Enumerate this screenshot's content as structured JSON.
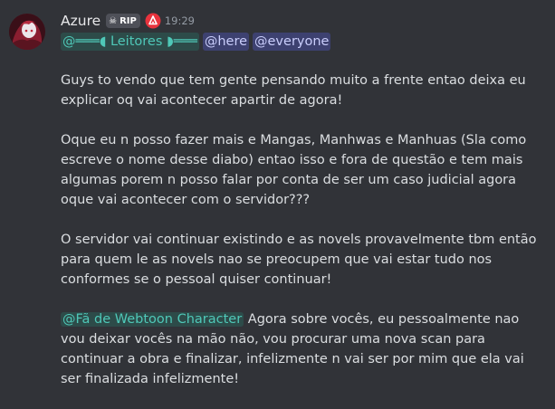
{
  "message": {
    "author": "Azure",
    "tag_icon": "skull-icon",
    "tag_label": "RIP",
    "badge_icon": "red-alert-badge-icon",
    "timestamp": "19:29",
    "mentions": {
      "role": "@═══◖ Leitores ◗═══",
      "here": "@here",
      "everyone": "@everyone"
    },
    "paragraphs": [
      "Guys to vendo que tem gente pensando muito a frente entao deixa eu explicar oq vai acontecer apartir de agora!",
      "Oque eu n posso fazer mais e Mangas, Manhwas e Manhuas (Sla como escreve o nome desse diabo) entao isso e fora de questão e tem mais algumas porem n posso falar por conta de ser um caso judicial agora oque vai acontecer com o servidor???",
      "O servidor vai continuar existindo e as novels provavelmente tbm então para quem le as novels nao se preocupem que vai estar tudo nos conformes se o pessoal quiser continuar!"
    ],
    "last_paragraph": {
      "mention": "@Fã de Webtoon Character",
      "text": " Agora sobre vocês, eu pessoalmente nao vou deixar vocês na mão não, vou procurar uma nova scan para continuar a obra e finalizar, infelizmente n vai ser por mim que ela vai ser finalizada infelizmente!"
    }
  },
  "colors": {
    "background": "#313338",
    "text": "#dbdee1",
    "mention_bg": "#3c4270",
    "mention_text": "#c9cdfb",
    "role_mention_text": "#4fc8b8",
    "timestamp": "#949ba4"
  }
}
